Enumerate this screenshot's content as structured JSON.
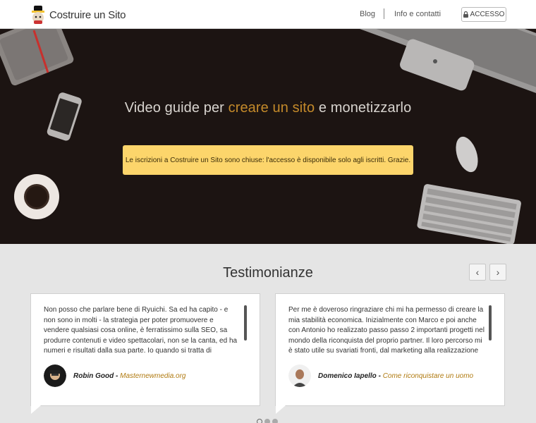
{
  "header": {
    "logo_text": "Costruire un Sito",
    "nav": {
      "blog": "Blog",
      "info": "Info e contatti"
    },
    "access_button": "ACCESSO"
  },
  "hero": {
    "title_before": "Video guide per ",
    "title_accent": "creare un sito",
    "title_after": " e monetizzarlo",
    "notice": "Le iscrizioni a Costruire un Sito sono chiuse: l'accesso è disponibile solo agli iscritti. Grazie."
  },
  "testimonials": {
    "title": "Testimonianze",
    "prev_icon": "‹",
    "next_icon": "›",
    "items": [
      {
        "text": "Non posso che parlare bene di Ryuichi. Sa ed ha capito - e non sono in molti - la strategia per poter promuovere e vendere qualsiasi cosa online, è ferratissimo sulla SEO, sa produrre contenuti e video spettacolari, non se la canta, ed ha numeri e risultati dalla sua parte. Io quando si tratta di posizionamento,",
        "author": "Robin Good",
        "separator": " - ",
        "link": "Masternewmedia.org"
      },
      {
        "text": "Per me è doveroso ringraziare chi mi ha permesso di creare la mia stabilità economica. Inizialmente con Marco e poi anche con Antonio ho realizzato passo passo 2 importanti progetti nel mondo della riconquista del proprio partner. Il loro percorso mi è stato utile su svariati fronti, dal marketing alla realizzazione di",
        "author": "Domenico Iapello",
        "separator": " - ",
        "link": "Come riconquistare un uomo"
      }
    ]
  }
}
